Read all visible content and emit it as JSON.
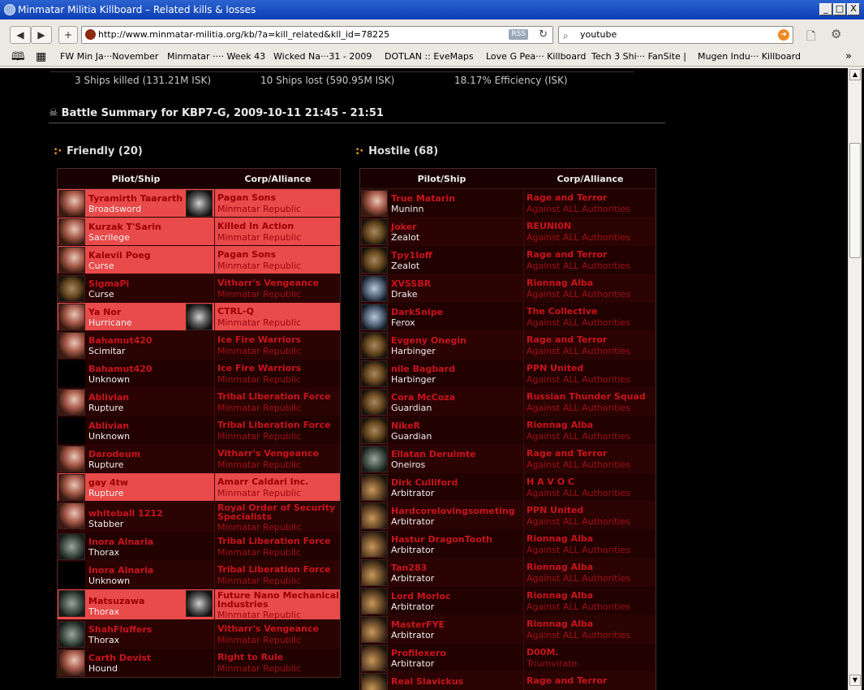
{
  "window": {
    "title": "Minmatar Militia Killboard – Related kills & losses",
    "btn_min": "_",
    "btn_max": "□",
    "btn_close": "X"
  },
  "nav": {
    "back": "◀",
    "forward": "▶",
    "add": "+",
    "url": "http://www.minmatar-militia.org/kb/?a=kill_related&kll_id=78225",
    "rss": "RSS",
    "reload": "↻",
    "search_value": "youtube",
    "page_icon": "🗋",
    "tools_icon": "⚙"
  },
  "bookmarks": {
    "reader": "🕮",
    "grid": "▦",
    "items": [
      "FW Min Ja···November",
      "Minmatar ···· Week 43",
      "Wicked Na···31 - 2009",
      "DOTLAN :: EveMaps",
      "Love G Pea··· Killboard",
      "Tech 3 Shi··· FanSite |",
      "Mugen Indu··· Killboard"
    ],
    "more": "»"
  },
  "summary": {
    "killed": "3 Ships killed (131.21M ISK)",
    "lost": "10 Ships lost (590.95M ISK)",
    "efficiency": "18.17% Efficiency (ISK)"
  },
  "battle": {
    "skull": "☠",
    "title": "Battle Summary for KBP7-G, 2009-10-11 21:45 - 21:51"
  },
  "friendly": {
    "marker": ":·",
    "title": "Friendly (20)",
    "col_pilot": "Pilot/Ship",
    "col_corp": "Corp/Alliance",
    "rows": [
      {
        "pilot": "Tyramirth Taararth",
        "ship": "Broadsword",
        "corp": "Pagan Sons",
        "alliance": "Minmatar Republic"
      },
      {
        "pilot": "Kurzak T'Sarin",
        "ship": "Sacrilege",
        "corp": "Killed In Action",
        "alliance": "Minmatar Republic"
      },
      {
        "pilot": "Kalevii Poeg",
        "ship": "Curse",
        "corp": "Pagan Sons",
        "alliance": "Minmatar Republic"
      },
      {
        "pilot": "SigmaPi",
        "ship": "Curse",
        "corp": "Vitharr's Vengeance",
        "alliance": "Minmatar Republic"
      },
      {
        "pilot": "Ya Nor",
        "ship": "Hurricane",
        "corp": "CTRL-Q",
        "alliance": "Minmatar Republic"
      },
      {
        "pilot": "Bahamut420",
        "ship": "Scimitar",
        "corp": "Ice Fire Warriors",
        "alliance": "Minmatar Republic"
      },
      {
        "pilot": "Bahamut420",
        "ship": "Unknown",
        "corp": "Ice Fire Warriors",
        "alliance": "Minmatar Republic"
      },
      {
        "pilot": "Ablivian",
        "ship": "Rupture",
        "corp": "Tribal Liberation Force",
        "alliance": "Minmatar Republic"
      },
      {
        "pilot": "Ablivian",
        "ship": "Unknown",
        "corp": "Tribal Liberation Force",
        "alliance": "Minmatar Republic"
      },
      {
        "pilot": "Darodeum",
        "ship": "Rupture",
        "corp": "Vitharr's Vengeance",
        "alliance": "Minmatar Republic"
      },
      {
        "pilot": "gay 4tw",
        "ship": "Rupture",
        "corp": "Amarr Caldari Inc.",
        "alliance": "Minmatar Republic"
      },
      {
        "pilot": "whiteball 1212",
        "ship": "Stabber",
        "corp": "Royal Order of Security",
        "corp2": "Specialists",
        "alliance": "Minmatar Republic"
      },
      {
        "pilot": "Inora Alnaria",
        "ship": "Thorax",
        "corp": "Tribal Liberation Force",
        "alliance": "Minmatar Republic"
      },
      {
        "pilot": "Inora Alnaria",
        "ship": "Unknown",
        "corp": "Tribal Liberation Force",
        "alliance": "Minmatar Republic"
      },
      {
        "pilot": "Matsuzawa",
        "ship": "Thorax",
        "corp": "Future Nano Mechanical",
        "corp2": "Industries",
        "alliance": "Minmatar Republic"
      },
      {
        "pilot": "ShahFluffers",
        "ship": "Thorax",
        "corp": "Vitharr's Vengeance",
        "alliance": "Minmatar Republic"
      },
      {
        "pilot": "Carth Devist",
        "ship": "Hound",
        "corp": "Right to Rule",
        "alliance": "Minmatar Republic"
      }
    ]
  },
  "hostile": {
    "marker": ":·",
    "title": "Hostile (68)",
    "col_pilot": "Pilot/Ship",
    "col_corp": "Corp/Alliance",
    "rows": [
      {
        "pilot": "True Matarin",
        "ship": "Muninn",
        "corp": "Rage and Terror",
        "alliance": "Against ALL Authorities"
      },
      {
        "pilot": "Joker",
        "ship": "Zealot",
        "corp": "REUNI0N",
        "alliance": "Against ALL Authorities"
      },
      {
        "pilot": "Tpy1Ioff",
        "ship": "Zealot",
        "corp": "Rage and Terror",
        "alliance": "Against ALL Authorities"
      },
      {
        "pilot": "XVSSBR",
        "ship": "Drake",
        "corp": "Rionnag Alba",
        "alliance": "Against ALL Authorities"
      },
      {
        "pilot": "DarkSnipe",
        "ship": "Ferox",
        "corp": "The Collective",
        "alliance": "Against ALL Authorities"
      },
      {
        "pilot": "Evgeny Onegin",
        "ship": "Harbinger",
        "corp": "Rage and Terror",
        "alliance": "Against ALL Authorities"
      },
      {
        "pilot": "nile Bagbard",
        "ship": "Harbinger",
        "corp": "PPN United",
        "alliance": "Against ALL Authorities"
      },
      {
        "pilot": "Cora McCoza",
        "ship": "Guardian",
        "corp": "Russian Thunder Squad",
        "alliance": "Against ALL Authorities"
      },
      {
        "pilot": "NikeR",
        "ship": "Guardian",
        "corp": "Rionnag Alba",
        "alliance": "Against ALL Authorities"
      },
      {
        "pilot": "Ellatan Deruimte",
        "ship": "Oneiros",
        "corp": "Rage and Terror",
        "alliance": "Against ALL Authorities"
      },
      {
        "pilot": "Dirk Culliford",
        "ship": "Arbitrator",
        "corp": "H A V O C",
        "alliance": "Against ALL Authorities"
      },
      {
        "pilot": "Hardcorelovingsometing",
        "ship": "Arbitrator",
        "corp": "PPN United",
        "alliance": "Against ALL Authorities"
      },
      {
        "pilot": "Hastur DragonTooth",
        "ship": "Arbitrator",
        "corp": "Rionnag Alba",
        "alliance": "Against ALL Authorities"
      },
      {
        "pilot": "Tan283",
        "ship": "Arbitrator",
        "corp": "Rionnag Alba",
        "alliance": "Against ALL Authorities"
      },
      {
        "pilot": "Lord Morloc",
        "ship": "Arbitrator",
        "corp": "Rionnag Alba",
        "alliance": "Against ALL Authorities"
      },
      {
        "pilot": "MasterFYE",
        "ship": "Arbitrator",
        "corp": "Rionnag Alba",
        "alliance": "Against ALL Authorities"
      },
      {
        "pilot": "Profilexero",
        "ship": "Arbitrator",
        "corp": "D00M.",
        "alliance": "Triumvirate."
      },
      {
        "pilot": "Real Slavickus",
        "ship": "",
        "corp": "Rage and Terror",
        "alliance": ""
      }
    ]
  },
  "scroll": {
    "up": "▲",
    "down": "▼"
  }
}
